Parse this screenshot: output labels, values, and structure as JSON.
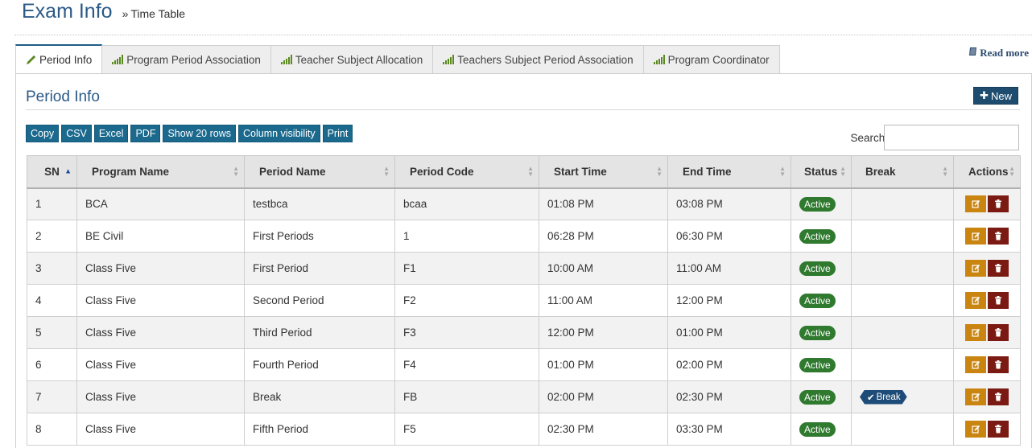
{
  "header": {
    "title": "Exam Info",
    "subtitle": "Time Table"
  },
  "tabs": [
    {
      "label": "Period Info",
      "icon": "pencil-icon",
      "active": true
    },
    {
      "label": "Program Period Association",
      "icon": "signal-bars-icon",
      "active": false
    },
    {
      "label": "Teacher Subject Allocation",
      "icon": "signal-bars-icon",
      "active": false
    },
    {
      "label": "Teachers Subject Period Association",
      "icon": "signal-bars-icon",
      "active": false
    },
    {
      "label": "Program Coordinator",
      "icon": "signal-bars-icon",
      "active": false
    }
  ],
  "read_more": "Read more",
  "section": {
    "title": "Period Info",
    "new_label": "New"
  },
  "export_buttons": [
    "Copy",
    "CSV",
    "Excel",
    "PDF",
    "Show 20 rows",
    "Column visibility",
    "Print"
  ],
  "search": {
    "label": "Search:",
    "value": ""
  },
  "table": {
    "columns": [
      "SN",
      "Program Name",
      "Period Name",
      "Period Code",
      "Start Time",
      "End Time",
      "Status",
      "Break",
      "Actions"
    ],
    "rows": [
      {
        "sn": "1",
        "program": "BCA",
        "period": "testbca",
        "code": "bcaa",
        "start": "01:08 PM",
        "end": "03:08 PM",
        "status": "Active",
        "break": ""
      },
      {
        "sn": "2",
        "program": "BE Civil",
        "period": "First Periods",
        "code": "1",
        "start": "06:28 PM",
        "end": "06:30 PM",
        "status": "Active",
        "break": ""
      },
      {
        "sn": "3",
        "program": "Class Five",
        "period": "First Period",
        "code": "F1",
        "start": "10:00 AM",
        "end": "11:00 AM",
        "status": "Active",
        "break": ""
      },
      {
        "sn": "4",
        "program": "Class Five",
        "period": "Second Period",
        "code": "F2",
        "start": "11:00 AM",
        "end": "12:00 PM",
        "status": "Active",
        "break": ""
      },
      {
        "sn": "5",
        "program": "Class Five",
        "period": "Third Period",
        "code": "F3",
        "start": "12:00 PM",
        "end": "01:00 PM",
        "status": "Active",
        "break": ""
      },
      {
        "sn": "6",
        "program": "Class Five",
        "period": "Fourth Period",
        "code": "F4",
        "start": "01:00 PM",
        "end": "02:00 PM",
        "status": "Active",
        "break": ""
      },
      {
        "sn": "7",
        "program": "Class Five",
        "period": "Break",
        "code": "FB",
        "start": "02:00 PM",
        "end": "02:30 PM",
        "status": "Active",
        "break": "Break"
      },
      {
        "sn": "8",
        "program": "Class Five",
        "period": "Fifth Period",
        "code": "F5",
        "start": "02:30 PM",
        "end": "03:30 PM",
        "status": "Active",
        "break": ""
      }
    ]
  },
  "colors": {
    "title": "#2b5a87",
    "button": "#1b6a8e",
    "active_badge": "#2f7a2f",
    "edit": "#c9850f",
    "delete": "#7a1a12"
  }
}
